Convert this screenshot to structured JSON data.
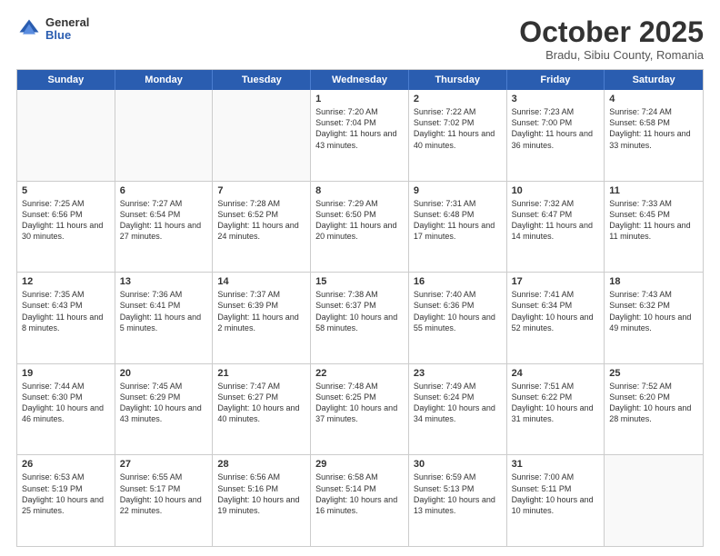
{
  "header": {
    "logo": {
      "general": "General",
      "blue": "Blue"
    },
    "title": "October 2025",
    "subtitle": "Bradu, Sibiu County, Romania"
  },
  "days": [
    "Sunday",
    "Monday",
    "Tuesday",
    "Wednesday",
    "Thursday",
    "Friday",
    "Saturday"
  ],
  "weeks": [
    [
      {
        "day": "",
        "content": ""
      },
      {
        "day": "",
        "content": ""
      },
      {
        "day": "",
        "content": ""
      },
      {
        "day": "1",
        "content": "Sunrise: 7:20 AM\nSunset: 7:04 PM\nDaylight: 11 hours\nand 43 minutes."
      },
      {
        "day": "2",
        "content": "Sunrise: 7:22 AM\nSunset: 7:02 PM\nDaylight: 11 hours\nand 40 minutes."
      },
      {
        "day": "3",
        "content": "Sunrise: 7:23 AM\nSunset: 7:00 PM\nDaylight: 11 hours\nand 36 minutes."
      },
      {
        "day": "4",
        "content": "Sunrise: 7:24 AM\nSunset: 6:58 PM\nDaylight: 11 hours\nand 33 minutes."
      }
    ],
    [
      {
        "day": "5",
        "content": "Sunrise: 7:25 AM\nSunset: 6:56 PM\nDaylight: 11 hours\nand 30 minutes."
      },
      {
        "day": "6",
        "content": "Sunrise: 7:27 AM\nSunset: 6:54 PM\nDaylight: 11 hours\nand 27 minutes."
      },
      {
        "day": "7",
        "content": "Sunrise: 7:28 AM\nSunset: 6:52 PM\nDaylight: 11 hours\nand 24 minutes."
      },
      {
        "day": "8",
        "content": "Sunrise: 7:29 AM\nSunset: 6:50 PM\nDaylight: 11 hours\nand 20 minutes."
      },
      {
        "day": "9",
        "content": "Sunrise: 7:31 AM\nSunset: 6:48 PM\nDaylight: 11 hours\nand 17 minutes."
      },
      {
        "day": "10",
        "content": "Sunrise: 7:32 AM\nSunset: 6:47 PM\nDaylight: 11 hours\nand 14 minutes."
      },
      {
        "day": "11",
        "content": "Sunrise: 7:33 AM\nSunset: 6:45 PM\nDaylight: 11 hours\nand 11 minutes."
      }
    ],
    [
      {
        "day": "12",
        "content": "Sunrise: 7:35 AM\nSunset: 6:43 PM\nDaylight: 11 hours\nand 8 minutes."
      },
      {
        "day": "13",
        "content": "Sunrise: 7:36 AM\nSunset: 6:41 PM\nDaylight: 11 hours\nand 5 minutes."
      },
      {
        "day": "14",
        "content": "Sunrise: 7:37 AM\nSunset: 6:39 PM\nDaylight: 11 hours\nand 2 minutes."
      },
      {
        "day": "15",
        "content": "Sunrise: 7:38 AM\nSunset: 6:37 PM\nDaylight: 10 hours\nand 58 minutes."
      },
      {
        "day": "16",
        "content": "Sunrise: 7:40 AM\nSunset: 6:36 PM\nDaylight: 10 hours\nand 55 minutes."
      },
      {
        "day": "17",
        "content": "Sunrise: 7:41 AM\nSunset: 6:34 PM\nDaylight: 10 hours\nand 52 minutes."
      },
      {
        "day": "18",
        "content": "Sunrise: 7:43 AM\nSunset: 6:32 PM\nDaylight: 10 hours\nand 49 minutes."
      }
    ],
    [
      {
        "day": "19",
        "content": "Sunrise: 7:44 AM\nSunset: 6:30 PM\nDaylight: 10 hours\nand 46 minutes."
      },
      {
        "day": "20",
        "content": "Sunrise: 7:45 AM\nSunset: 6:29 PM\nDaylight: 10 hours\nand 43 minutes."
      },
      {
        "day": "21",
        "content": "Sunrise: 7:47 AM\nSunset: 6:27 PM\nDaylight: 10 hours\nand 40 minutes."
      },
      {
        "day": "22",
        "content": "Sunrise: 7:48 AM\nSunset: 6:25 PM\nDaylight: 10 hours\nand 37 minutes."
      },
      {
        "day": "23",
        "content": "Sunrise: 7:49 AM\nSunset: 6:24 PM\nDaylight: 10 hours\nand 34 minutes."
      },
      {
        "day": "24",
        "content": "Sunrise: 7:51 AM\nSunset: 6:22 PM\nDaylight: 10 hours\nand 31 minutes."
      },
      {
        "day": "25",
        "content": "Sunrise: 7:52 AM\nSunset: 6:20 PM\nDaylight: 10 hours\nand 28 minutes."
      }
    ],
    [
      {
        "day": "26",
        "content": "Sunrise: 6:53 AM\nSunset: 5:19 PM\nDaylight: 10 hours\nand 25 minutes."
      },
      {
        "day": "27",
        "content": "Sunrise: 6:55 AM\nSunset: 5:17 PM\nDaylight: 10 hours\nand 22 minutes."
      },
      {
        "day": "28",
        "content": "Sunrise: 6:56 AM\nSunset: 5:16 PM\nDaylight: 10 hours\nand 19 minutes."
      },
      {
        "day": "29",
        "content": "Sunrise: 6:58 AM\nSunset: 5:14 PM\nDaylight: 10 hours\nand 16 minutes."
      },
      {
        "day": "30",
        "content": "Sunrise: 6:59 AM\nSunset: 5:13 PM\nDaylight: 10 hours\nand 13 minutes."
      },
      {
        "day": "31",
        "content": "Sunrise: 7:00 AM\nSunset: 5:11 PM\nDaylight: 10 hours\nand 10 minutes."
      },
      {
        "day": "",
        "content": ""
      }
    ]
  ]
}
